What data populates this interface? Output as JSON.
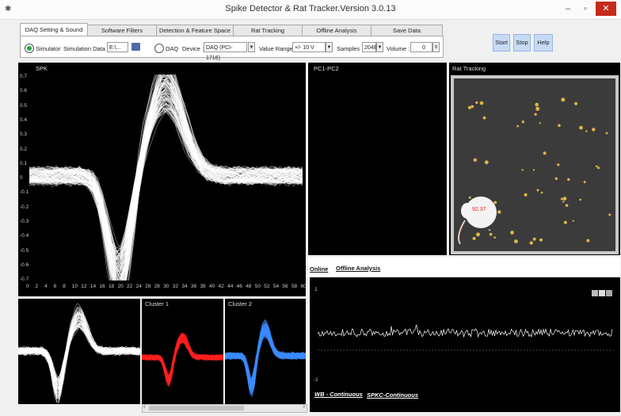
{
  "window": {
    "title": "Spike Detector & Rat Tracker.Version 3.0.13",
    "app_icon": "✱",
    "minimize": "–",
    "maximize": "▫",
    "close": "✕"
  },
  "tabs": [
    "DAQ Setting & Sound",
    "Software Filters",
    "Detection & Feature Space",
    "Rat Tracking",
    "Offline Analysis",
    "Save Data"
  ],
  "daq": {
    "simulator_label": "Simulator",
    "simulation_data_label": "Simulation Data :",
    "simulation_data_value": "E:\\...",
    "daq_label": "DAQ",
    "device_label": "Device :",
    "device_value": "DAQ (PCI-1716)",
    "range_label": "Value Range :",
    "range_value": "+/- 10 V",
    "samples_label": "Samples :",
    "samples_value": "2048",
    "volume_label": "Volume :",
    "volume_value": "0"
  },
  "actions": {
    "start": "Start",
    "stop": "Stop",
    "help": "Help"
  },
  "spk": {
    "title": "SPK",
    "y_ticks": [
      "0.7",
      "0.6",
      "0.5",
      "0.4",
      "0.3",
      "0.2",
      "0.1",
      "0",
      "-0.1",
      "-0.2",
      "-0.3",
      "-0.4",
      "-0.5",
      "-0.6",
      "-0.7"
    ],
    "x_ticks": [
      "0",
      "2",
      "4",
      "6",
      "8",
      "10",
      "12",
      "14",
      "16",
      "18",
      "20",
      "22",
      "24",
      "26",
      "28",
      "30",
      "32",
      "34",
      "36",
      "38",
      "40",
      "42",
      "44",
      "46",
      "48",
      "50",
      "52",
      "54",
      "56",
      "58",
      "60"
    ]
  },
  "pc": {
    "title": "PC1-PC2"
  },
  "rat": {
    "title": "Rat Tracking",
    "readout": "92.37"
  },
  "clusters": {
    "c1": "Cluster 1",
    "c2": "Cluster 2"
  },
  "online": {
    "tab_online": "Online",
    "tab_offline": "Offline Analysis",
    "y_top": "1",
    "y_bottom": "-1",
    "link_wb": "WB - Continuous",
    "link_spkc": "SPKC-Continuous"
  },
  "colors": {
    "accent_green": "#22a844",
    "cluster1": "#ff2020",
    "cluster2": "#3a8cff",
    "button": "#c7dbf7"
  }
}
